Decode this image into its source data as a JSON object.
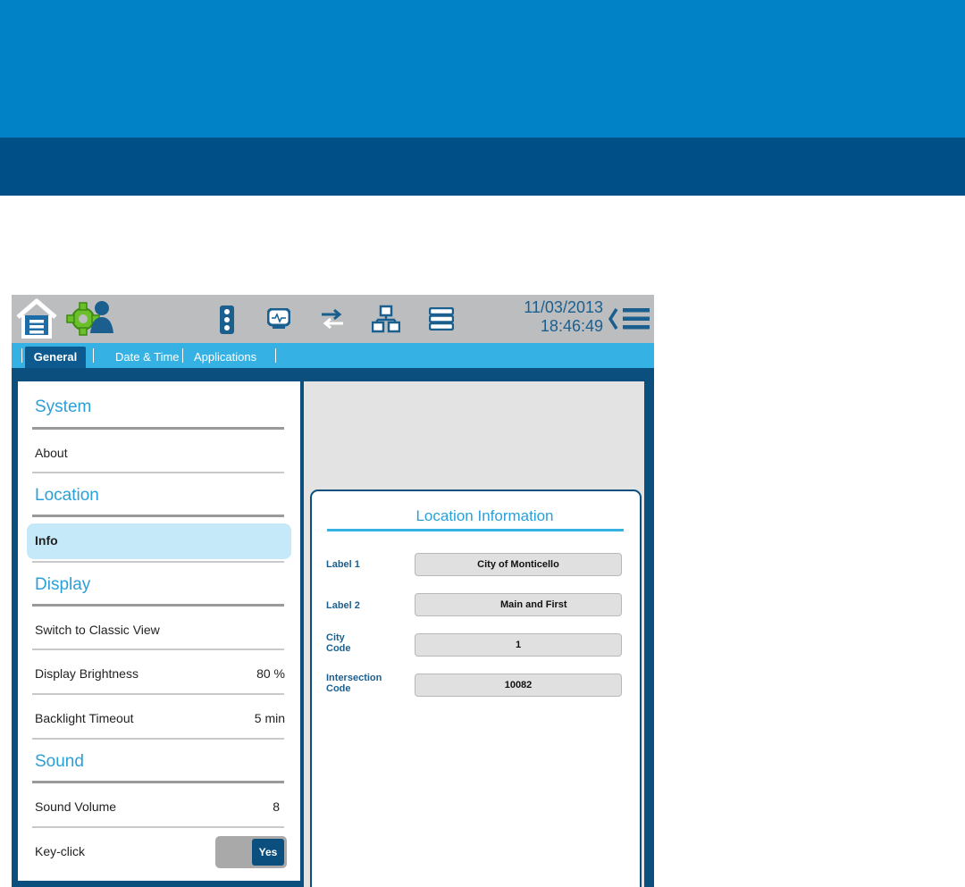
{
  "status_bar": {
    "date": "11/03/2013",
    "time": "18:46:49",
    "icons": [
      "home-icon",
      "settings-user-icon",
      "traffic-light-icon",
      "monitor-icon",
      "transfer-icon",
      "network-icon",
      "database-icon",
      "menu-back-icon"
    ]
  },
  "tabs": [
    {
      "label": "General",
      "active": true
    },
    {
      "label": "Date & Time",
      "active": false
    },
    {
      "label": "Applications",
      "active": false
    }
  ],
  "settings": {
    "system": {
      "heading": "System",
      "about": "About"
    },
    "location": {
      "heading": "Location",
      "info": "Info"
    },
    "display": {
      "heading": "Display",
      "classic_view": "Switch to Classic View",
      "brightness_label": "Display Brightness",
      "brightness_value": "80 %",
      "backlight_label": "Backlight Timeout",
      "backlight_value": "5 min"
    },
    "sound": {
      "heading": "Sound",
      "volume_label": "Sound Volume",
      "volume_value": "8",
      "keyclick_label": "Key-click",
      "keyclick_value": "Yes"
    }
  },
  "location_info": {
    "title": "Location Information",
    "fields": [
      {
        "label": "Label 1",
        "value": "City of Monticello"
      },
      {
        "label": "Label 2",
        "value": "Main and First"
      },
      {
        "label": "City Code",
        "value": "1"
      },
      {
        "label": "Intersection Code",
        "value": "10082"
      }
    ]
  },
  "colors": {
    "brand_blue": "#0181c6",
    "dark_blue": "#005087",
    "navy": "#0a4f7d",
    "accent": "#36b1e4"
  }
}
